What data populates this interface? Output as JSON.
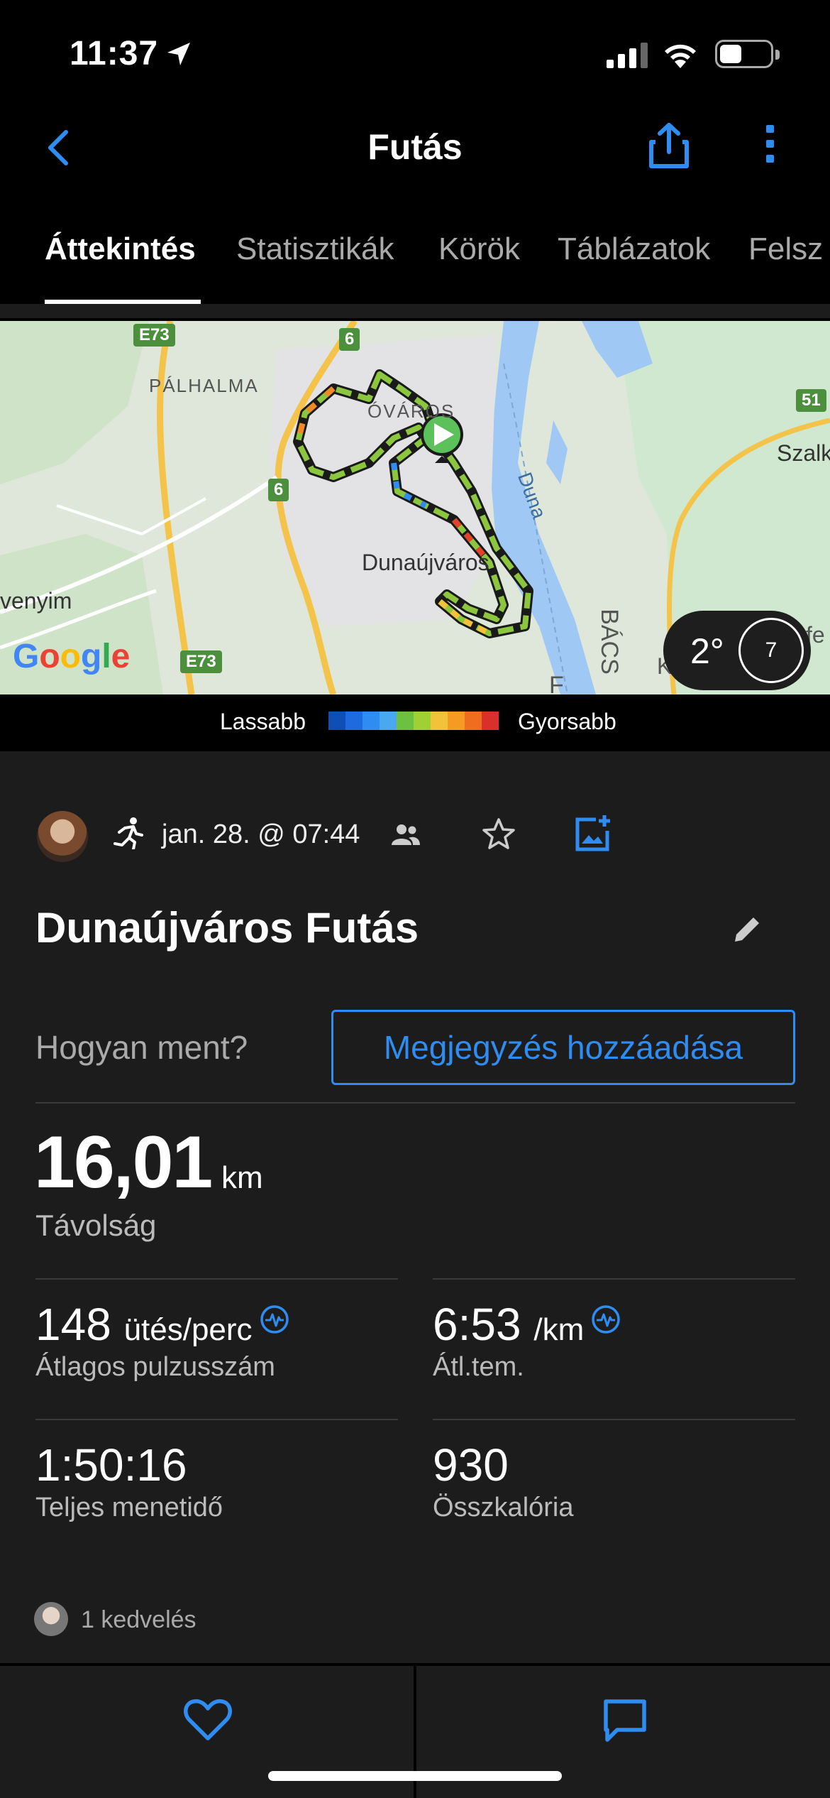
{
  "status_bar": {
    "time": "11:37"
  },
  "nav": {
    "title": "Futás"
  },
  "tabs": [
    {
      "label": "Áttekintés"
    },
    {
      "label": "Statisztikák"
    },
    {
      "label": "Körök"
    },
    {
      "label": "Táblázatok"
    },
    {
      "label": "Felsz"
    }
  ],
  "map": {
    "labels": {
      "palhalma": "PÁLHALMA",
      "ovaros": "ÓVÁROS",
      "city": "Dunaújváros",
      "river": "Duna",
      "west": "venyim",
      "east": "Szalk",
      "bacs": "BÁCS",
      "f": "F",
      "k": "K",
      "fe": "fe"
    },
    "road_shields": {
      "e73_top": "E73",
      "r6_top": "6",
      "r6_mid": "6",
      "e73_bottom": "E73",
      "r51": "51"
    },
    "google": "Google",
    "weather": {
      "temp": "2°",
      "wind": "7"
    }
  },
  "legend": {
    "slow": "Lassabb",
    "fast": "Gyorsabb",
    "colors": [
      "#0d4fb5",
      "#1e6be0",
      "#2f8df2",
      "#4aa8f0",
      "#6cc140",
      "#9fd134",
      "#f3c23b",
      "#f59a23",
      "#ef6d1e",
      "#d9312a"
    ]
  },
  "activity": {
    "date": "jan. 28. @ 07:44",
    "title": "Dunaújváros Futás",
    "how_question": "Hogyan ment?",
    "add_note": "Megjegyzés hozzáadása",
    "distance": {
      "value": "16,01",
      "unit": "km",
      "label": "Távolság"
    },
    "stats": [
      {
        "value": "148",
        "unit": "ütés/perc",
        "label": "Átlagos pulzusszám",
        "hr_icon": true
      },
      {
        "value": "6:53",
        "unit": "/km",
        "label": "Átl.tem.",
        "hr_icon": true
      },
      {
        "value": "1:50:16",
        "unit": "",
        "label": "Teljes menetidő",
        "hr_icon": false
      },
      {
        "value": "930",
        "unit": "",
        "label": "Összkalória",
        "hr_icon": false
      }
    ],
    "likes": "1 kedvelés"
  }
}
